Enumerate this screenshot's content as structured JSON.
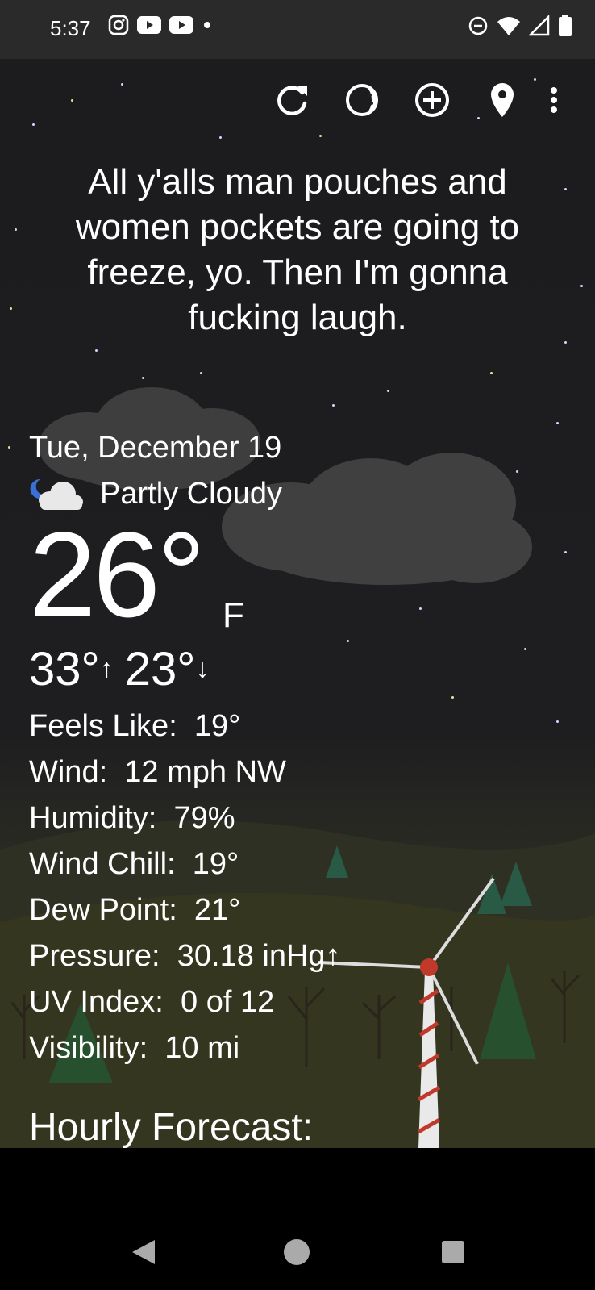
{
  "status_bar": {
    "time": "5:37",
    "left_icons": [
      "instagram-icon",
      "youtube-icon",
      "youtube-icon",
      "dot-icon"
    ],
    "right_icons": [
      "do-not-disturb-icon",
      "wifi-icon",
      "signal-icon",
      "battery-icon"
    ]
  },
  "toolbar": {
    "icons": [
      "refresh-icon",
      "moon-phase-icon",
      "add-location-icon",
      "location-pin-icon",
      "more-vert-icon"
    ]
  },
  "quote": "All y'alls man pouches and women pockets are going to freeze, yo. Then I'm gonna fucking laugh.",
  "current": {
    "date": "Tue, December 19",
    "condition": "Partly Cloudy",
    "condition_icon": "partly-cloudy-night-icon",
    "temperature": "26°",
    "unit": "F",
    "high": "33°",
    "low": "23°"
  },
  "details": [
    {
      "label": "Feels Like:",
      "value": "19°"
    },
    {
      "label": "Wind:",
      "value": "12 mph NW"
    },
    {
      "label": "Humidity:",
      "value": "79%"
    },
    {
      "label": "Wind Chill:",
      "value": "19°"
    },
    {
      "label": "Dew Point:",
      "value": "21°"
    },
    {
      "label": "Pressure:",
      "value": "30.18 inHg↑"
    },
    {
      "label": "UV Index:",
      "value": "0 of 12"
    },
    {
      "label": "Visibility:",
      "value": "10 mi"
    }
  ],
  "hourly_title": "Hourly Forecast:",
  "nav": [
    "back-icon",
    "home-icon",
    "recents-icon"
  ],
  "colors": {
    "status_bar": "#2a2a2a",
    "sky": "#1c1c1e",
    "ground": "#33331f",
    "text": "#ffffff"
  }
}
